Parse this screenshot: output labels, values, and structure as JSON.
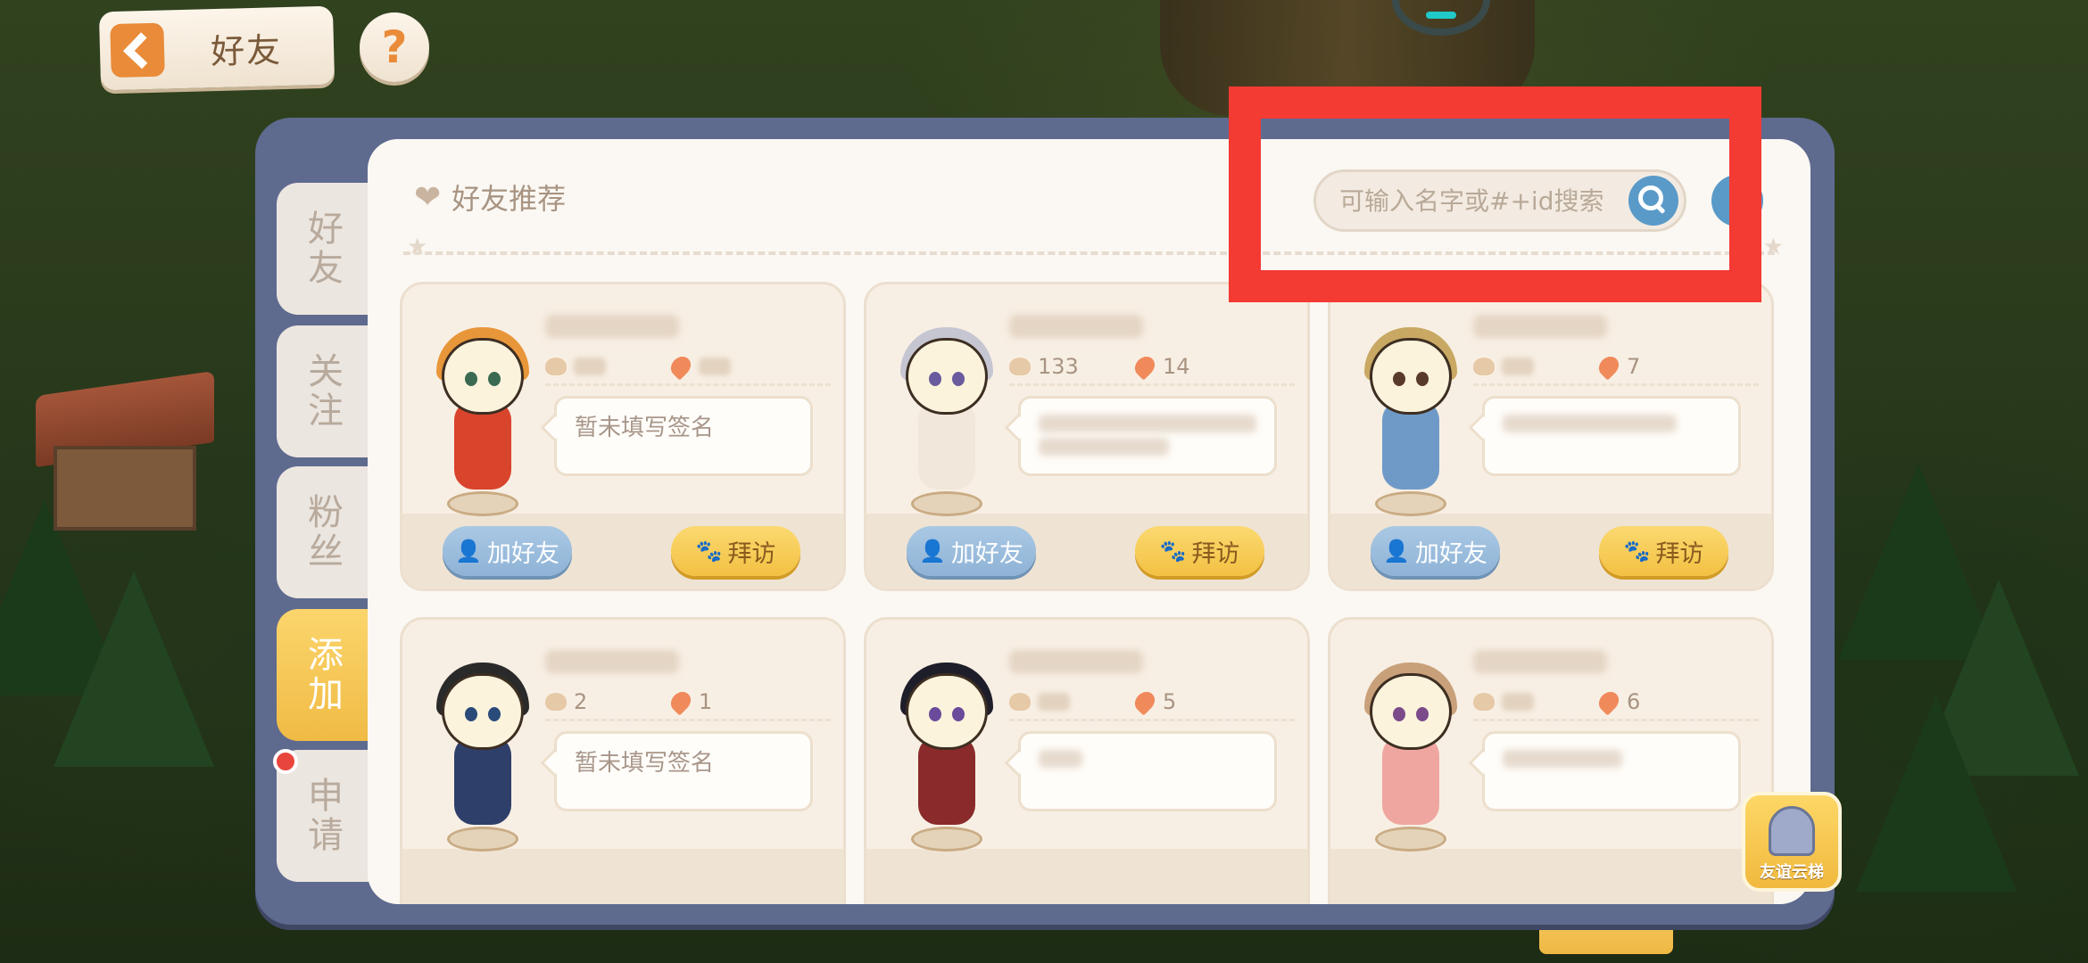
{
  "header": {
    "title": "好友",
    "help_symbol": "?"
  },
  "tabs": [
    {
      "label": [
        "好",
        "友"
      ]
    },
    {
      "label": [
        "关",
        "注"
      ]
    },
    {
      "label": [
        "粉",
        "丝"
      ]
    },
    {
      "label": [
        "添",
        "加"
      ],
      "active": true
    },
    {
      "label": [
        "申",
        "请"
      ],
      "badge": "red-dot"
    }
  ],
  "section": {
    "title": "好友推荐"
  },
  "search": {
    "placeholder": "可输入名字或#+id搜索"
  },
  "cards": [
    {
      "likes": "",
      "fire": "",
      "signature": "暂未填写签名",
      "signature_hidden": false
    },
    {
      "likes": "133",
      "fire": "14",
      "signature": "",
      "signature_hidden": true
    },
    {
      "likes": "",
      "fire": "7",
      "signature": "",
      "signature_hidden": true
    },
    {
      "likes": "2",
      "fire": "1",
      "signature": "暂未填写签名",
      "signature_hidden": false
    },
    {
      "likes": "",
      "fire": "5",
      "signature": "",
      "signature_hidden": true
    },
    {
      "likes": "",
      "fire": "6",
      "signature": "",
      "signature_hidden": true
    }
  ],
  "buttons": {
    "add_friend": "加好友",
    "visit": "拜访"
  },
  "ladder": {
    "label": "友谊云梯"
  },
  "colors": {
    "accent_yellow": "#f3c143",
    "accent_blue": "#8fb3d6",
    "highlight_red": "#f33a33",
    "frame": "#5f6a8f"
  }
}
